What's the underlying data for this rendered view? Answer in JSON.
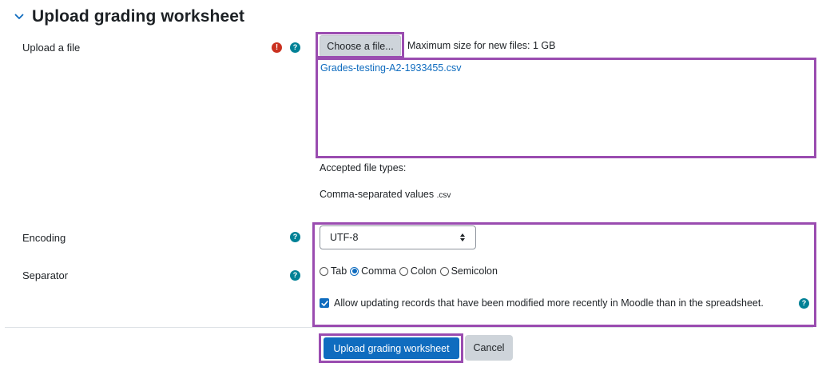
{
  "section": {
    "title": "Upload grading worksheet",
    "toggle_icon": "chevron-down-icon"
  },
  "upload": {
    "label": "Upload a file",
    "required_glyph": "!",
    "help_glyph": "?",
    "choose_button": "Choose a file...",
    "max_size": "Maximum size for new files: 1 GB",
    "file_name": "Grades-testing-A2-1933455.csv",
    "accepted_title": "Accepted file types:",
    "accepted_type": "Comma-separated values",
    "accepted_ext": ".csv"
  },
  "encoding": {
    "label": "Encoding",
    "selected": "UTF-8"
  },
  "separator": {
    "label": "Separator",
    "options": [
      {
        "label": "Tab",
        "checked": false
      },
      {
        "label": "Comma",
        "checked": true
      },
      {
        "label": "Colon",
        "checked": false
      },
      {
        "label": "Semicolon",
        "checked": false
      }
    ]
  },
  "override": {
    "checked": true,
    "label": "Allow updating records that have been modified more recently in Moodle than in the spreadsheet."
  },
  "actions": {
    "submit": "Upload grading worksheet",
    "cancel": "Cancel"
  },
  "colors": {
    "primary": "#0f6cbf",
    "help": "#008196",
    "required": "#ca3120",
    "highlight": "#9a4cb0"
  }
}
